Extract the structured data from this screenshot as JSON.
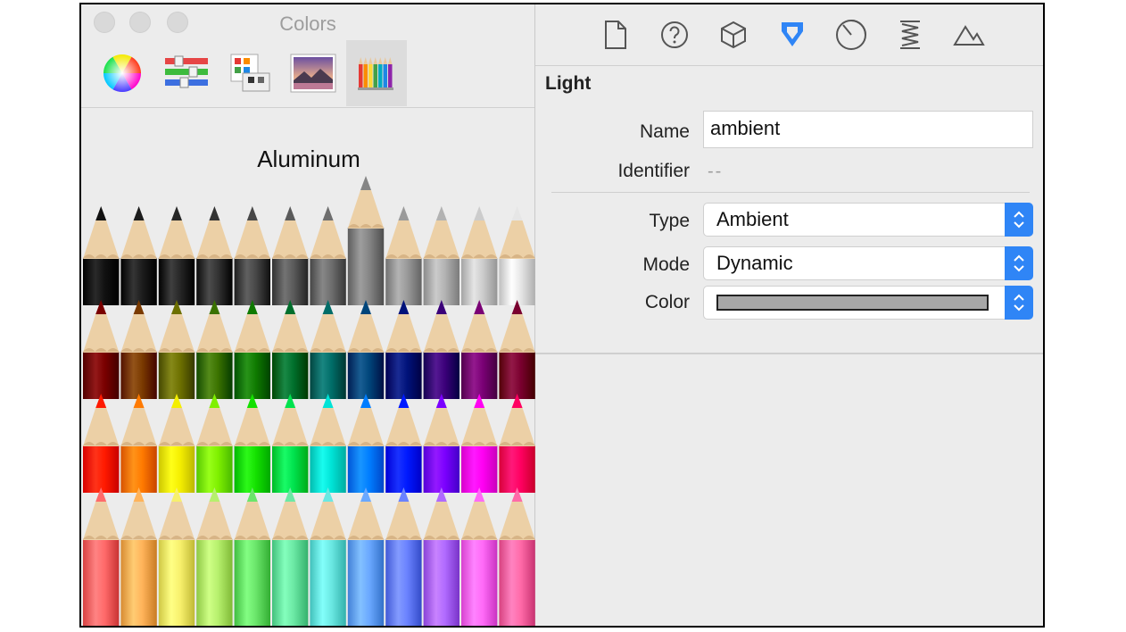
{
  "colors_panel": {
    "title": "Colors",
    "palette_name": "Aluminum",
    "modes": [
      "color-wheel-icon",
      "color-sliders-icon",
      "color-palettes-icon",
      "image-palettes-icon",
      "pencils-icon"
    ],
    "active_mode": 4,
    "pencil_rows": [
      [
        "#111111",
        "#1c1c1c",
        "#262626",
        "#333333",
        "#474747",
        "#5a5a5a",
        "#6e6e6e",
        "#858585",
        "#9a9a9a",
        "#b2b2b2",
        "#cccccc",
        "#e6e6e6"
      ],
      [
        "#7a0000",
        "#7a3a00",
        "#6d7000",
        "#3b7200",
        "#0f7a00",
        "#006f2c",
        "#006d68",
        "#00457a",
        "#00127a",
        "#3b0079",
        "#7a0075",
        "#7a002f"
      ],
      [
        "#ff1a00",
        "#ff7a00",
        "#f4ee00",
        "#7ff000",
        "#14e000",
        "#00e24e",
        "#00e3d6",
        "#007dff",
        "#0019ff",
        "#7b00ff",
        "#ff00f2",
        "#ff0061"
      ],
      [
        "#ff6a6a",
        "#ffb35a",
        "#f7f06c",
        "#b6f06d",
        "#6ae56a",
        "#6be8a4",
        "#6ae8e2",
        "#6aa8ff",
        "#6a82ff",
        "#b06aff",
        "#ff6af7",
        "#ff6aa8"
      ]
    ],
    "raised_pencil": {
      "row": 0,
      "col": 7
    }
  },
  "inspector": {
    "tabs": [
      "file-icon",
      "help-icon",
      "cube-icon",
      "attributes-icon",
      "dial-icon",
      "spring-icon",
      "scene-icon"
    ],
    "active_tab": 3,
    "accent_color": "#2f85f6",
    "section_title": "Light",
    "name_label": "Name",
    "name_value": "ambient",
    "identifier_label": "Identifier",
    "identifier_value": "--",
    "type_label": "Type",
    "type_value": "Ambient",
    "mode_label": "Mode",
    "mode_value": "Dynamic",
    "color_label": "Color",
    "color_value": "#a7a7a7"
  }
}
